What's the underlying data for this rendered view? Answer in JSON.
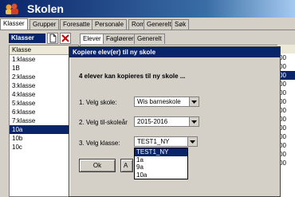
{
  "app": {
    "title": "Skolen"
  },
  "main_tabs": [
    {
      "label": "Klasser"
    },
    {
      "label": "Grupper"
    },
    {
      "label": "Foresatte"
    },
    {
      "label": "Personale"
    },
    {
      "label": "Rom"
    },
    {
      "label": "Generelt"
    },
    {
      "label": "Søk"
    }
  ],
  "classes_panel": {
    "header": "Klasser",
    "list_header": "Klasse",
    "items": [
      "1:klasse",
      "1B",
      "2:klasse",
      "3:klasse",
      "4:klasse",
      "5:klasse",
      "6:klasse",
      "7:klasse",
      "10a",
      "10b",
      "10c"
    ],
    "selected": "10a"
  },
  "sub_tabs": [
    {
      "label": "Elever"
    },
    {
      "label": "Fagløerere"
    },
    {
      "label": "Generelt"
    }
  ],
  "right_strip": [
    "00",
    "00",
    "00",
    "00",
    "00",
    "00",
    "00",
    "00",
    "00",
    "00",
    "00",
    "00",
    "00",
    "00"
  ],
  "dialog": {
    "title": "Kopiere elev(er) til ny skole",
    "message": "4 elever kan kopieres til ny skole ...",
    "school_label": "1. Velg skole:",
    "school_value": "Wis barneskole",
    "year_label": "2. Velg til-skoleår",
    "year_value": "2015-2016",
    "class_label": "3. Velg klasse:",
    "class_value": "TEST1_NY",
    "class_options": [
      "TEST1_NY",
      "1a",
      "9a",
      "10a"
    ],
    "ok_label": "Ok",
    "cancel_label": "A"
  },
  "colors": {
    "selection": "#0a246a",
    "chrome": "#d4d0c8"
  }
}
